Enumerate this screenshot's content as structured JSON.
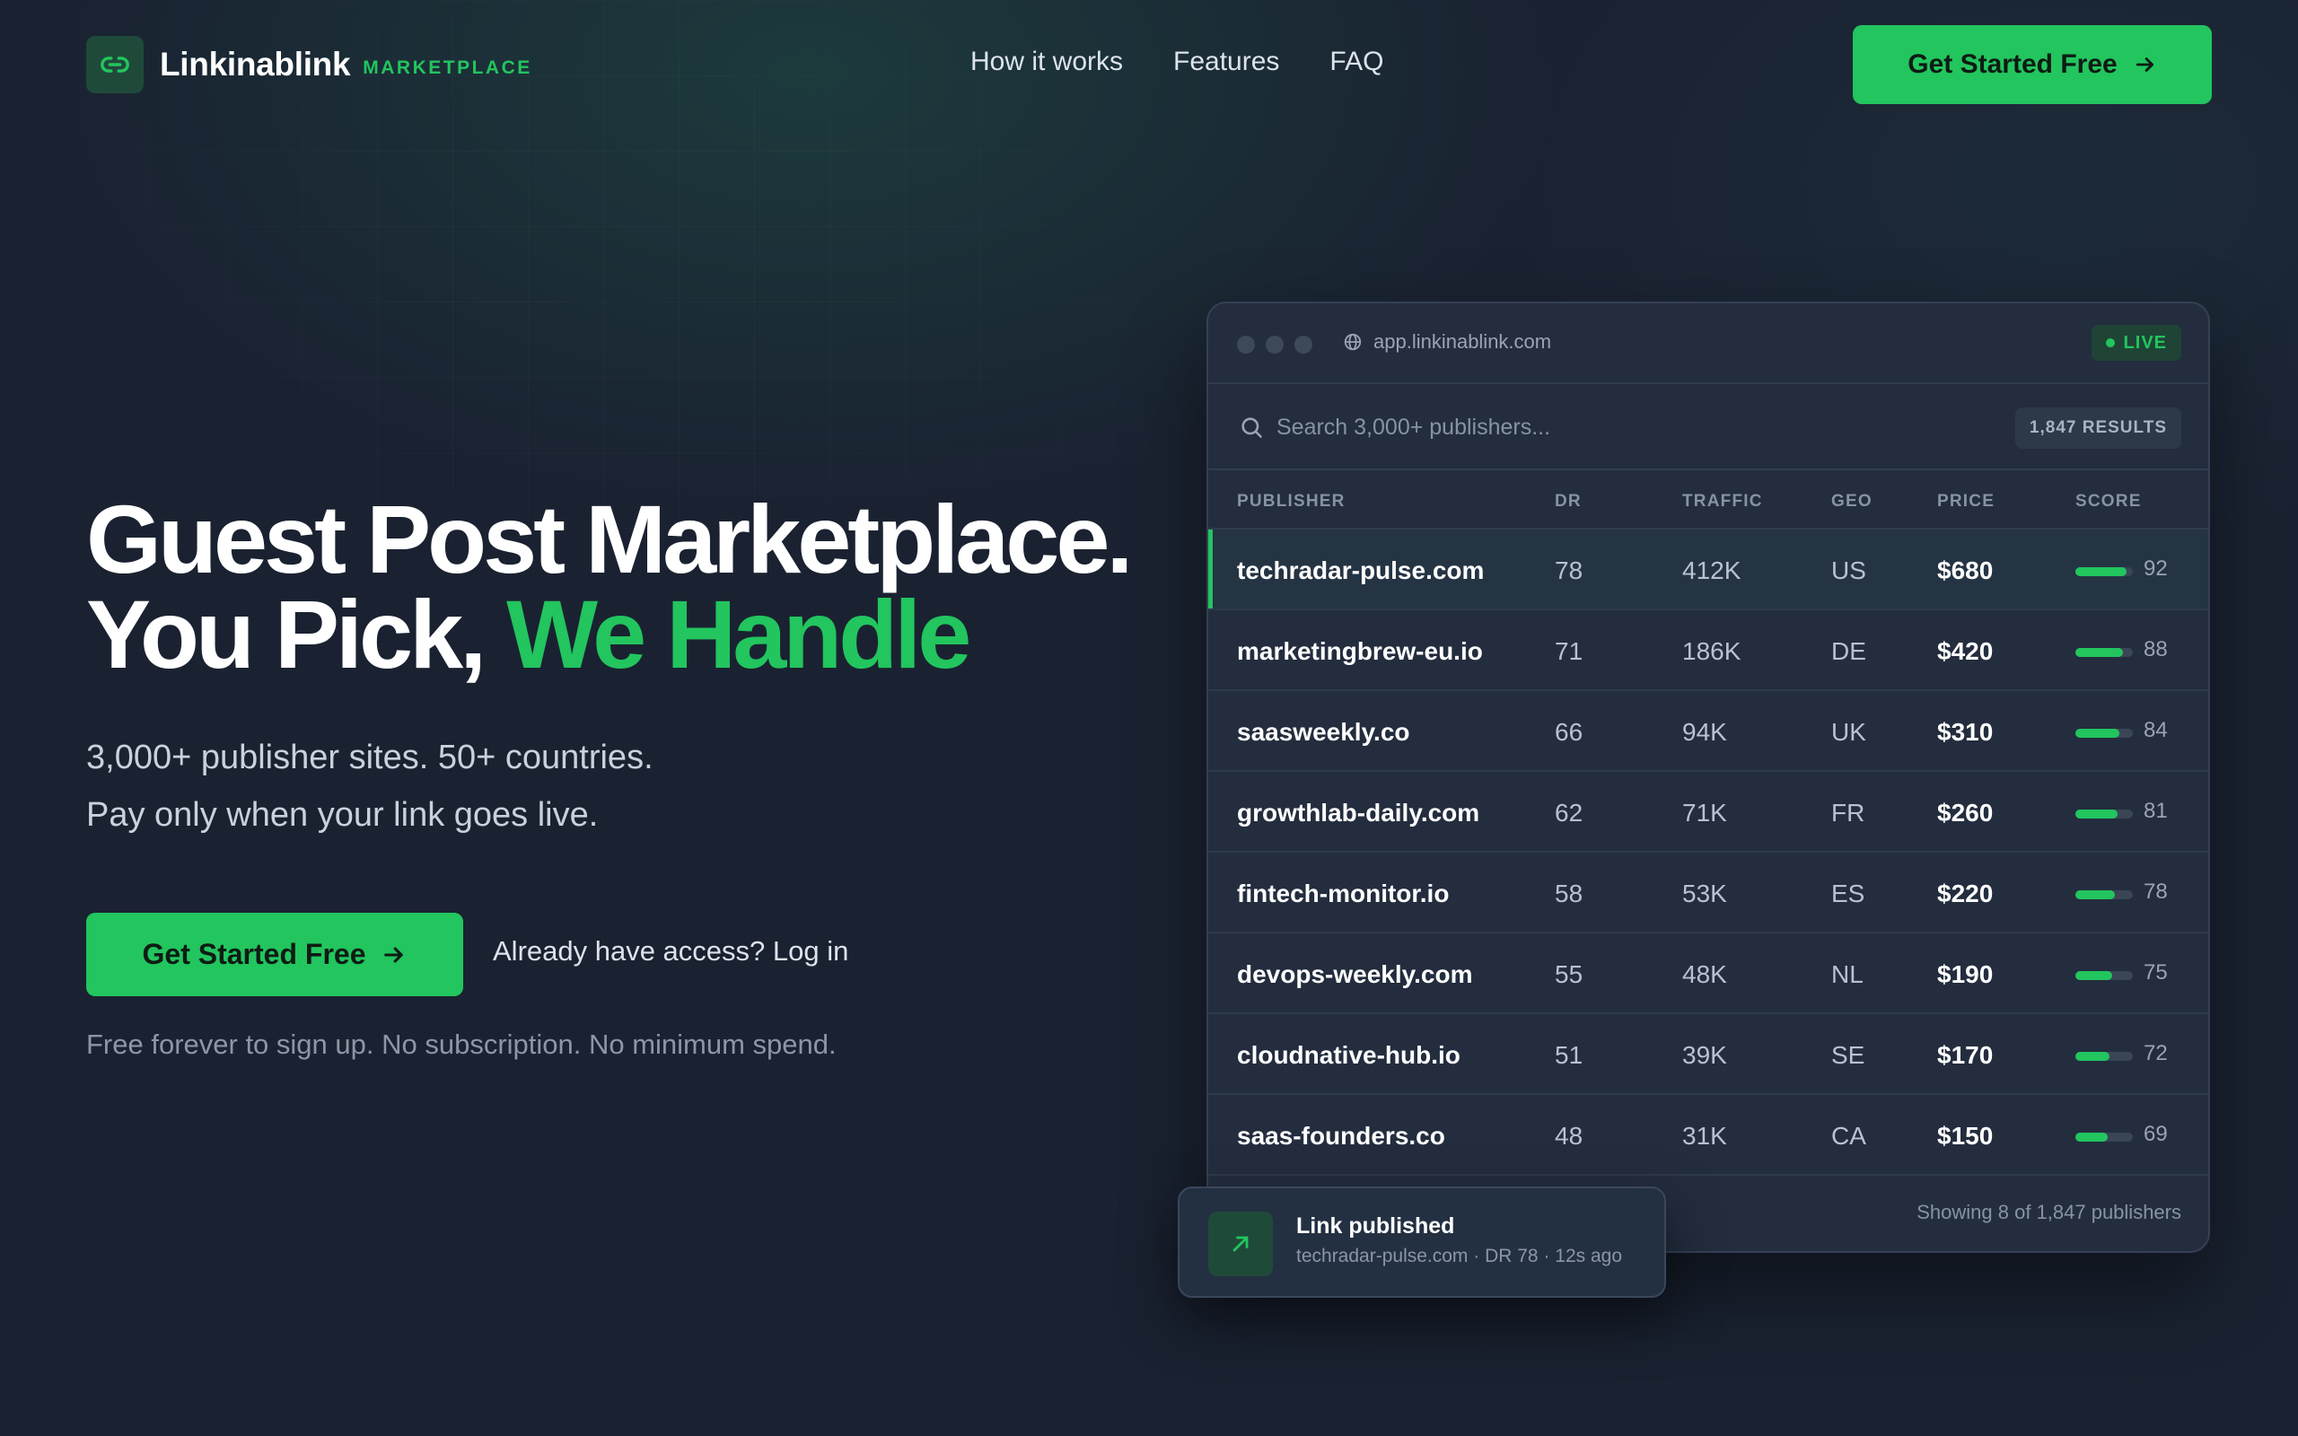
{
  "brand": {
    "name": "Linkinablink",
    "tag": "MARKETPLACE"
  },
  "nav": {
    "links": [
      "How it works",
      "Features",
      "FAQ"
    ],
    "cta_label": "Get Started Free"
  },
  "hero": {
    "title_line1": "Guest Post Marketplace.",
    "title_line2_plain": "You Pick, ",
    "title_line2_accent": "We Handle",
    "sub_line1": "3,000+ publisher sites. 50+ countries.",
    "sub_line2": "Pay only when your link goes live.",
    "cta_label": "Get Started Free",
    "login_text": "Already have access? Log in",
    "fine_print": "Free forever to sign up. No subscription. No minimum spend."
  },
  "app": {
    "url": "app.linkinablink.com",
    "live_label": "LIVE",
    "search_placeholder": "Search 3,000+ publishers...",
    "results_badge": "1,847 RESULTS",
    "columns": [
      "PUBLISHER",
      "DR",
      "TRAFFIC",
      "GEO",
      "PRICE",
      "SCORE"
    ],
    "rows": [
      {
        "publisher": "techradar-pulse.com",
        "dr": "78",
        "traffic": "412K",
        "geo": "US",
        "price": "$680",
        "score": 92
      },
      {
        "publisher": "marketingbrew-eu.io",
        "dr": "71",
        "traffic": "186K",
        "geo": "DE",
        "price": "$420",
        "score": 88
      },
      {
        "publisher": "saasweekly.co",
        "dr": "66",
        "traffic": "94K",
        "geo": "UK",
        "price": "$310",
        "score": 84
      },
      {
        "publisher": "growthlab-daily.com",
        "dr": "62",
        "traffic": "71K",
        "geo": "FR",
        "price": "$260",
        "score": 81
      },
      {
        "publisher": "fintech-monitor.io",
        "dr": "58",
        "traffic": "53K",
        "geo": "ES",
        "price": "$220",
        "score": 78
      },
      {
        "publisher": "devops-weekly.com",
        "dr": "55",
        "traffic": "48K",
        "geo": "NL",
        "price": "$190",
        "score": 75
      },
      {
        "publisher": "cloudnative-hub.io",
        "dr": "51",
        "traffic": "39K",
        "geo": "SE",
        "price": "$170",
        "score": 72
      },
      {
        "publisher": "saas-founders.co",
        "dr": "48",
        "traffic": "31K",
        "geo": "CA",
        "price": "$150",
        "score": 69
      }
    ],
    "footer": "Showing 8 of 1,847 publishers"
  },
  "toast": {
    "title": "Link published",
    "subtitle": "techradar-pulse.com · DR 78 · 12s ago"
  },
  "icons": {
    "logo": "link-icon",
    "cta": "arrow-right-icon",
    "url": "globe-icon",
    "search": "search-icon",
    "toast": "arrow-up-right-icon"
  },
  "colors": {
    "accent": "#22c55e",
    "background": "#1a2231",
    "panel": "#232d3e"
  }
}
